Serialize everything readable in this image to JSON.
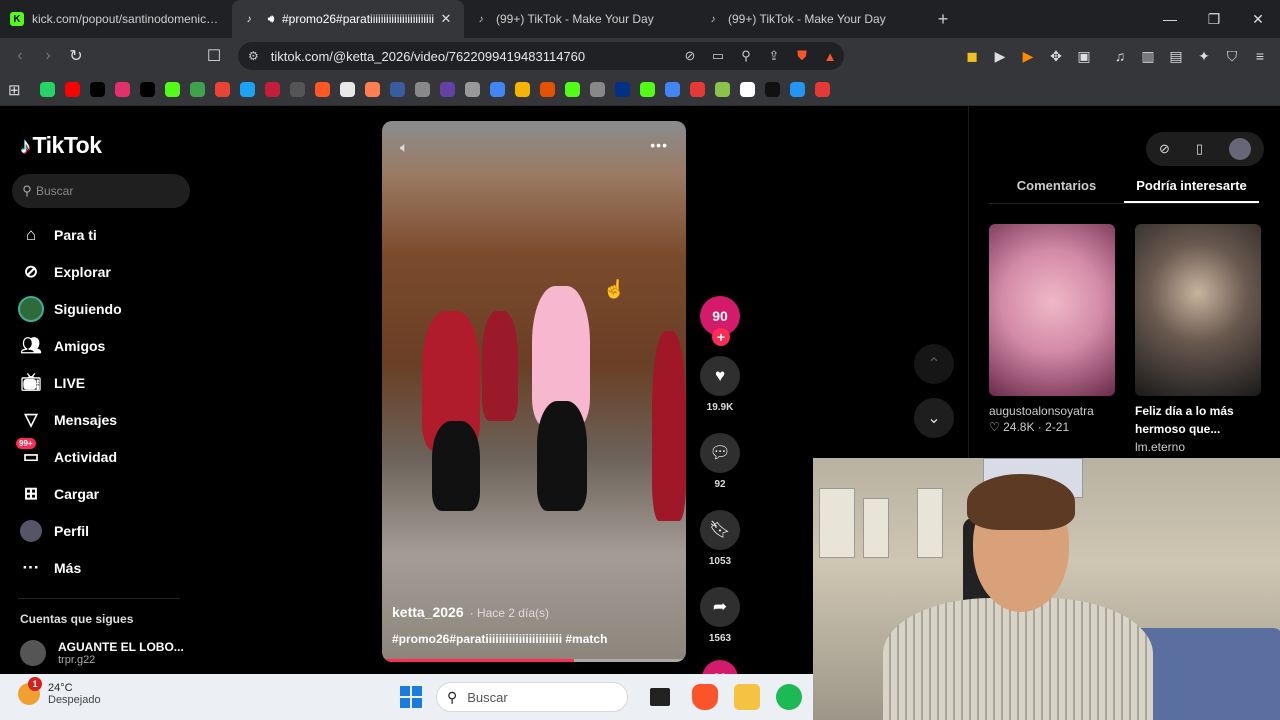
{
  "browser": {
    "tabs": [
      {
        "title": "kick.com/popout/santinodomenichini/chat",
        "favicon": "K",
        "color": "#53fc18",
        "active": false
      },
      {
        "title": "#promo26#paratiiiiiiiiiiiiiiiiiiiiiiii",
        "favicon": "♪",
        "color": "#ffffff",
        "active": true
      },
      {
        "title": "(99+) TikTok - Make Your Day",
        "favicon": "♪",
        "color": "#ffffff",
        "active": false
      },
      {
        "title": "(99+) TikTok - Make Your Day",
        "favicon": "♪",
        "color": "#ffffff",
        "active": false
      }
    ],
    "url": "tiktok.com/@ketta_2026/video/7622099419483114760",
    "bookmark_colors": [
      "#25d366",
      "#ff0000",
      "#000000",
      "#e1306c",
      "#000000",
      "#53fc18",
      "#3fa34d",
      "#ea4335",
      "#1da1f2",
      "#c41e3a",
      "#555555",
      "#ff5722",
      "#e8e8e8",
      "#ff7f50",
      "#3a5ba0",
      "#888888",
      "#6441a5",
      "#999999",
      "#4285f4",
      "#f4b400",
      "#e65100",
      "#53fc18",
      "#888888",
      "#003087",
      "#53fc18",
      "#4285f4",
      "#e53935",
      "#8bc34a",
      "#ffffff",
      "#111111",
      "#2196f3",
      "#e53935"
    ]
  },
  "tiktok": {
    "brand": "TikTok",
    "search_placeholder": "Buscar",
    "nav": [
      {
        "label": "Para ti",
        "icon": "home-icon"
      },
      {
        "label": "Explorar",
        "icon": "compass-icon"
      },
      {
        "label": "Siguiendo",
        "icon": "following-avatar-icon"
      },
      {
        "label": "Amigos",
        "icon": "friends-icon"
      },
      {
        "label": "LIVE",
        "icon": "live-tv-icon"
      },
      {
        "label": "Mensajes",
        "icon": "messages-icon"
      },
      {
        "label": "Actividad",
        "icon": "activity-icon",
        "badge": "99+"
      },
      {
        "label": "Cargar",
        "icon": "upload-icon"
      },
      {
        "label": "Perfil",
        "icon": "profile-avatar-icon"
      },
      {
        "label": "Más",
        "icon": "more-icon"
      }
    ],
    "following_header": "Cuentas que sigues",
    "following": [
      {
        "name": "AGUANTE EL LOBO...",
        "handle": "trpr.g22"
      }
    ],
    "video": {
      "username": "ketta_2026",
      "time": "· Hace 2 día(s)",
      "caption": "#promo26#paratiiiiiiiiiiiiiiiiiiiiiii #match",
      "progress_fraction": 0.63
    },
    "creator_avatar_text": "90",
    "actions": [
      {
        "icon": "heart-icon",
        "count": "19.9K"
      },
      {
        "icon": "comment-icon",
        "count": "92"
      },
      {
        "icon": "bookmark-icon",
        "count": "1053"
      },
      {
        "icon": "share-icon",
        "count": "1563"
      }
    ],
    "panel": {
      "tabs": [
        "Comentarios",
        "Podría interesarte"
      ],
      "active_tab": 1,
      "items": [
        {
          "user": "augustoalonsoyatra",
          "likes": "24.8K",
          "date": "2-21"
        },
        {
          "title": "Feliz día a lo más hermoso que...",
          "user": "lm.eterno"
        }
      ]
    }
  },
  "taskbar": {
    "temperature": "24°C",
    "condition": "Despejado",
    "weather_badge": "1",
    "search_placeholder": "Buscar"
  }
}
